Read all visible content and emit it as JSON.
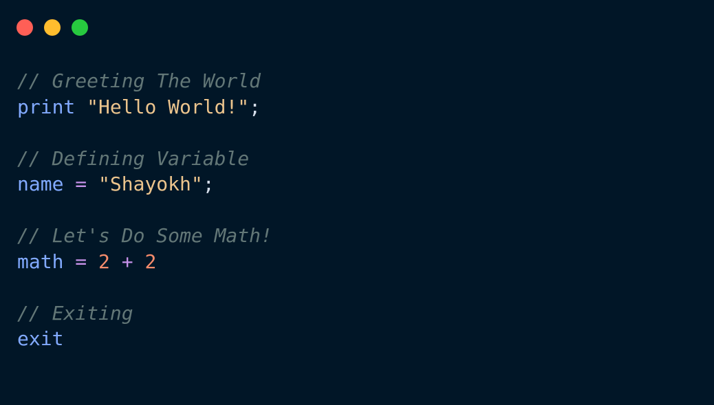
{
  "colors": {
    "background": "#011627",
    "close": "#FF5F56",
    "minimize": "#FFBD2E",
    "maximize": "#27C93F",
    "comment": "#637777",
    "keyword": "#82AAFF",
    "string": "#ECC48D",
    "number": "#F78C6C",
    "operator": "#C792EA",
    "text": "#D6DEEB"
  },
  "window_controls": [
    {
      "name": "close-button",
      "icon": "red-circle-icon"
    },
    {
      "name": "minimize-button",
      "icon": "yellow-circle-icon"
    },
    {
      "name": "maximize-button",
      "icon": "green-circle-icon"
    }
  ],
  "code": {
    "comment_1": "// Greeting The World",
    "line_1": {
      "keyword": "print",
      "space": " ",
      "string": "\"Hello World!\"",
      "semicolon": ";"
    },
    "comment_2": "// Defining Variable",
    "line_2": {
      "variable": "name",
      "space_1": " ",
      "operator": "=",
      "space_2": " ",
      "string": "\"Shayokh\"",
      "semicolon": ";"
    },
    "comment_3": "// Let's Do Some Math!",
    "line_3": {
      "variable": "math",
      "space_1": " ",
      "equals": "=",
      "space_2": " ",
      "number_1": "2",
      "space_3": " ",
      "plus": "+",
      "space_4": " ",
      "number_2": "2"
    },
    "comment_4": "// Exiting",
    "line_4": {
      "keyword": "exit"
    }
  }
}
